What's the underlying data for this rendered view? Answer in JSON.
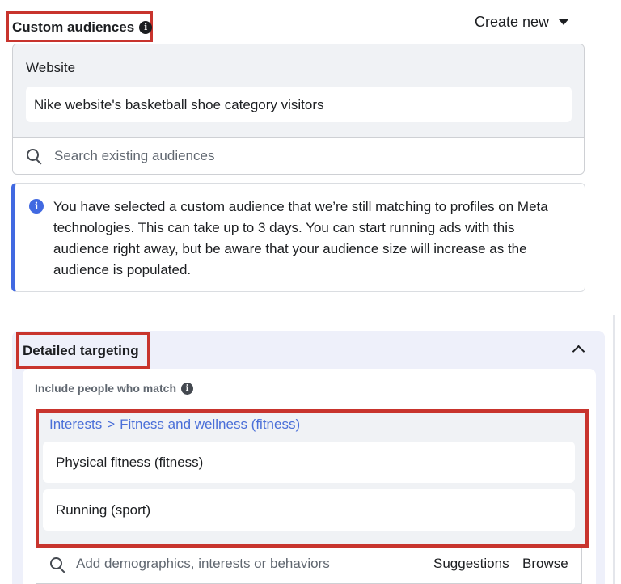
{
  "custom_audiences": {
    "title": "Custom audiences",
    "info_icon": "info-icon",
    "create_new_label": "Create new",
    "website_label": "Website",
    "selected_audience": "Nike website's basketball shoe category visitors",
    "search_placeholder": "Search existing audiences"
  },
  "notice": {
    "icon": "info-icon",
    "text": "You have selected a custom audience that we’re still matching to profiles on Meta technologies. This can take up to 3 days. You can start running ads with this audience right away, but be aware that your audience size will increase as the audience is populated."
  },
  "detailed_targeting": {
    "title": "Detailed targeting",
    "include_label": "Include people who match",
    "breadcrumb": {
      "root": "Interests",
      "separator": ">",
      "category": "Fitness and wellness (fitness)"
    },
    "interests": [
      {
        "label": "Physical fitness (fitness)"
      },
      {
        "label": "Running (sport)"
      }
    ],
    "search_placeholder": "Add demographics, interests or behaviors",
    "suggestions_label": "Suggestions",
    "browse_label": "Browse"
  },
  "colors": {
    "highlight_box": "#c8342d",
    "accent_blue": "#4169e1",
    "link_blue": "#4a6fd8",
    "panel_gray": "#f0f2f5",
    "targeting_bg": "#eef0fa"
  }
}
